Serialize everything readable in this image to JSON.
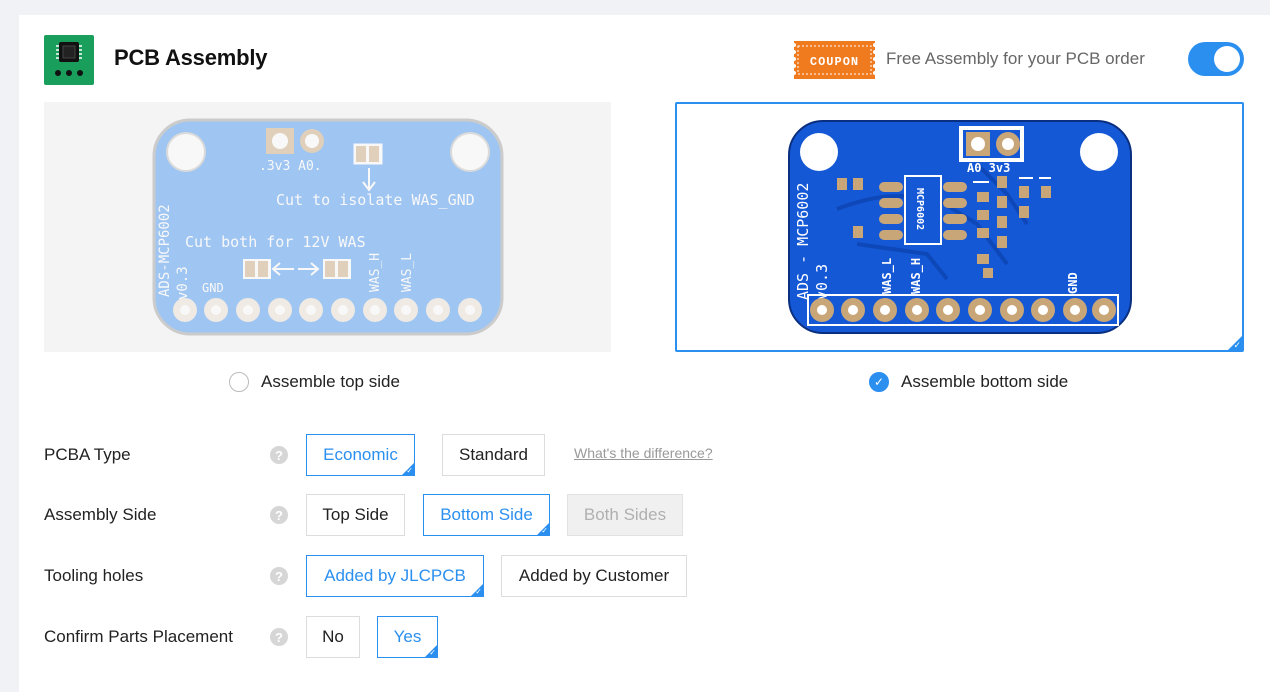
{
  "header": {
    "title": "PCB Assembly",
    "coupon_badge": "COUPON",
    "coupon_text": "Free Assembly for your PCB order",
    "toggle_on": true
  },
  "boards": {
    "top": {
      "label": "Assemble top side",
      "selected": false,
      "silk": {
        "pin_labels": ".3v3 A0.",
        "cut_isolate": "Cut to isolate WAS_GND",
        "cut_both": "Cut both for 12V WAS",
        "model": "ADS-MCP6002",
        "version": "v0.3",
        "gnd": "GND",
        "was_h": "WAS_H",
        "was_l": "WAS_L"
      }
    },
    "bottom": {
      "label": "Assemble bottom side",
      "selected": true,
      "silk": {
        "pin_labels": "A0  3v3",
        "model": "ADS - MCP6002",
        "version": "v0.3",
        "chip": "MCP6002",
        "was_l": "WAS_L",
        "was_h": "WAS_H",
        "gnd": "GND"
      }
    }
  },
  "options": {
    "pcba_type": {
      "label": "PCBA Type",
      "choices": [
        "Economic",
        "Standard"
      ],
      "selected": "Economic",
      "link": "What's the difference?"
    },
    "assembly_side": {
      "label": "Assembly Side",
      "choices": [
        "Top Side",
        "Bottom Side",
        "Both Sides"
      ],
      "selected": "Bottom Side",
      "disabled": "Both Sides"
    },
    "tooling_holes": {
      "label": "Tooling holes",
      "choices": [
        "Added by JLCPCB",
        "Added by Customer"
      ],
      "selected": "Added by JLCPCB"
    },
    "confirm_parts": {
      "label": "Confirm Parts Placement",
      "choices": [
        "No",
        "Yes"
      ],
      "selected": "Yes"
    }
  },
  "colors": {
    "accent": "#2b8ff0",
    "board_blue": "#1458d6",
    "coupon_orange": "#f07a1e",
    "pcb_icon_green": "#1a9e5c"
  },
  "icons": {
    "help": "question-circle-icon",
    "check": "checkmark-icon"
  }
}
